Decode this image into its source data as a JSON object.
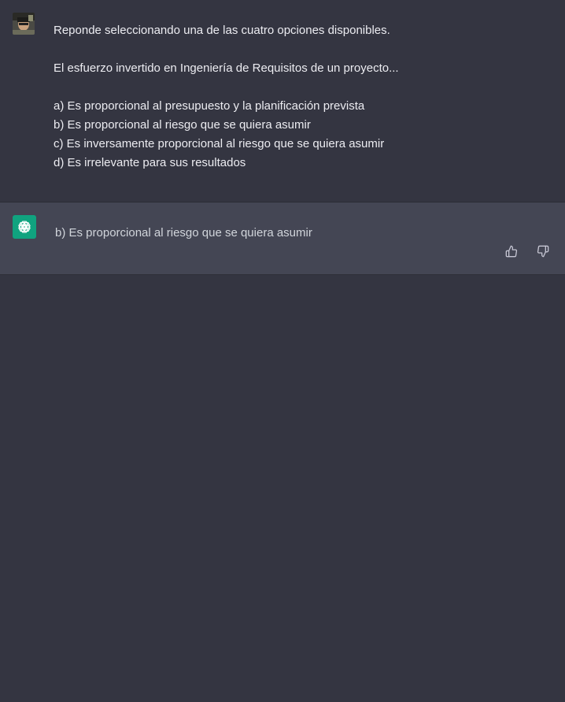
{
  "user_message": {
    "lines": [
      "Reponde seleccionando una de las cuatro opciones disponibles.",
      "",
      "El esfuerzo invertido en Ingeniería de Requisitos de un proyecto...",
      "",
      "a) Es proporcional al presupuesto y la planificación prevista",
      "b) Es proporcional al riesgo que se quiera asumir",
      "c) Es inversamente proporcional al riesgo que se quiera asumir",
      "d) Es irrelevante para sus resultados"
    ]
  },
  "assistant_message": {
    "text": "b) Es proporcional al riesgo que se quiera asumir"
  },
  "icons": {
    "user_avatar": "user-avatar-photo",
    "assistant_avatar": "openai-logo-icon",
    "thumbs_up": "thumbs-up-icon",
    "thumbs_down": "thumbs-down-icon"
  },
  "colors": {
    "background": "#343541",
    "assistant_background": "#444654",
    "accent": "#10a37f"
  }
}
